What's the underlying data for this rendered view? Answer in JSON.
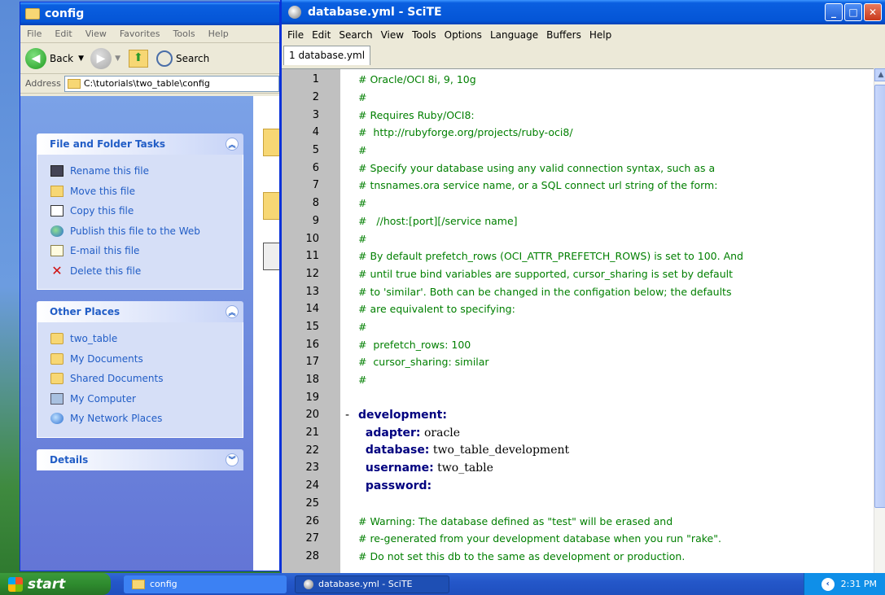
{
  "explorer": {
    "title": "config",
    "menu": [
      "File",
      "Edit",
      "View",
      "Favorites",
      "Tools",
      "Help"
    ],
    "toolbar": {
      "back_label": "Back",
      "search_label": "Search"
    },
    "address": {
      "label": "Address",
      "value": "C:\\tutorials\\two_table\\config"
    },
    "tasks": {
      "title": "File and Folder Tasks",
      "items": [
        {
          "label": "Rename this file",
          "icon": "rename-icon"
        },
        {
          "label": "Move this file",
          "icon": "move-icon"
        },
        {
          "label": "Copy this file",
          "icon": "copy-icon"
        },
        {
          "label": "Publish this file to the Web",
          "icon": "publish-web-icon"
        },
        {
          "label": "E-mail this file",
          "icon": "email-icon"
        },
        {
          "label": "Delete this file",
          "icon": "delete-icon"
        }
      ]
    },
    "places": {
      "title": "Other Places",
      "items": [
        {
          "label": "two_table",
          "icon": "folder-icon"
        },
        {
          "label": "My Documents",
          "icon": "folder-icon"
        },
        {
          "label": "Shared Documents",
          "icon": "folder-icon"
        },
        {
          "label": "My Computer",
          "icon": "computer-icon"
        },
        {
          "label": "My Network Places",
          "icon": "network-icon"
        }
      ]
    },
    "details": {
      "title": "Details"
    }
  },
  "scite": {
    "title": "database.yml - SciTE",
    "menu": [
      "File",
      "Edit",
      "Search",
      "View",
      "Tools",
      "Options",
      "Language",
      "Buffers",
      "Help"
    ],
    "tab": "1 database.yml",
    "lines": [
      {
        "n": "1",
        "kind": "comment",
        "text": "# Oracle/OCI 8i, 9, 10g"
      },
      {
        "n": "2",
        "kind": "comment",
        "text": "#"
      },
      {
        "n": "3",
        "kind": "comment",
        "text": "# Requires Ruby/OCI8:"
      },
      {
        "n": "4",
        "kind": "comment",
        "text": "#  http://rubyforge.org/projects/ruby-oci8/"
      },
      {
        "n": "5",
        "kind": "comment",
        "text": "#"
      },
      {
        "n": "6",
        "kind": "comment",
        "text": "# Specify your database using any valid connection syntax, such as a"
      },
      {
        "n": "7",
        "kind": "comment",
        "text": "# tnsnames.ora service name, or a SQL connect url string of the form:"
      },
      {
        "n": "8",
        "kind": "comment",
        "text": "#"
      },
      {
        "n": "9",
        "kind": "comment",
        "text": "#   //host:[port][/service name]"
      },
      {
        "n": "10",
        "kind": "comment",
        "text": "#"
      },
      {
        "n": "11",
        "kind": "comment",
        "text": "# By default prefetch_rows (OCI_ATTR_PREFETCH_ROWS) is set to 100. And"
      },
      {
        "n": "12",
        "kind": "comment",
        "text": "# until true bind variables are supported, cursor_sharing is set by default"
      },
      {
        "n": "13",
        "kind": "comment",
        "text": "# to 'similar'. Both can be changed in the configation below; the defaults"
      },
      {
        "n": "14",
        "kind": "comment",
        "text": "# are equivalent to specifying:"
      },
      {
        "n": "15",
        "kind": "comment",
        "text": "#"
      },
      {
        "n": "16",
        "kind": "comment",
        "text": "#  prefetch_rows: 100"
      },
      {
        "n": "17",
        "kind": "comment",
        "text": "#  cursor_sharing: similar"
      },
      {
        "n": "18",
        "kind": "comment",
        "text": "#"
      },
      {
        "n": "19",
        "kind": "blank",
        "text": ""
      },
      {
        "n": "20",
        "kind": "yaml",
        "key": "development:",
        "value": "",
        "indent": "",
        "fold": "-"
      },
      {
        "n": "21",
        "kind": "yaml",
        "key": "adapter:",
        "value": " oracle",
        "indent": "  "
      },
      {
        "n": "22",
        "kind": "yaml",
        "key": "database:",
        "value": " two_table_development",
        "indent": "  "
      },
      {
        "n": "23",
        "kind": "yaml",
        "key": "username:",
        "value": " two_table",
        "indent": "  "
      },
      {
        "n": "24",
        "kind": "yaml",
        "key": "password:",
        "value": "",
        "indent": "  "
      },
      {
        "n": "25",
        "kind": "blank",
        "text": ""
      },
      {
        "n": "26",
        "kind": "comment",
        "text": "# Warning: The database defined as \"test\" will be erased and"
      },
      {
        "n": "27",
        "kind": "comment",
        "text": "# re-generated from your development database when you run \"rake\"."
      },
      {
        "n": "28",
        "kind": "comment",
        "text": "# Do not set this db to the same as development or production."
      }
    ]
  },
  "taskbar": {
    "start_label": "start",
    "tasks": [
      "config",
      "database.yml - SciTE"
    ],
    "clock": "2:31 PM"
  }
}
